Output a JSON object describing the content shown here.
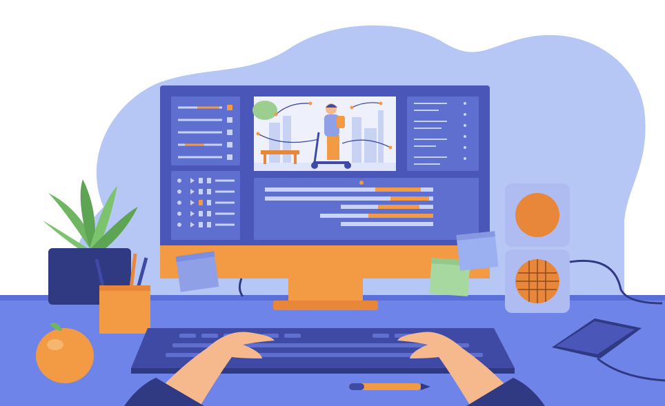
{
  "scene": {
    "subject": "",
    "palette": {
      "background_blob": "#b7c7f5",
      "desk": "#6e84e8",
      "desk_edge": "#5366cf",
      "monitor_bezel": "#4a56b8",
      "monitor_panel": "#5e6fd0",
      "monitor_stand": "#f39a45",
      "accent_orange": "#f39a45",
      "keyboard": "#3e4aa3",
      "speaker": "#aebcf2",
      "speaker_cone": "#e8863a",
      "plant_leaf": "#6fb562",
      "pot": "#2f3a82",
      "skin": "#f6b88d"
    }
  }
}
